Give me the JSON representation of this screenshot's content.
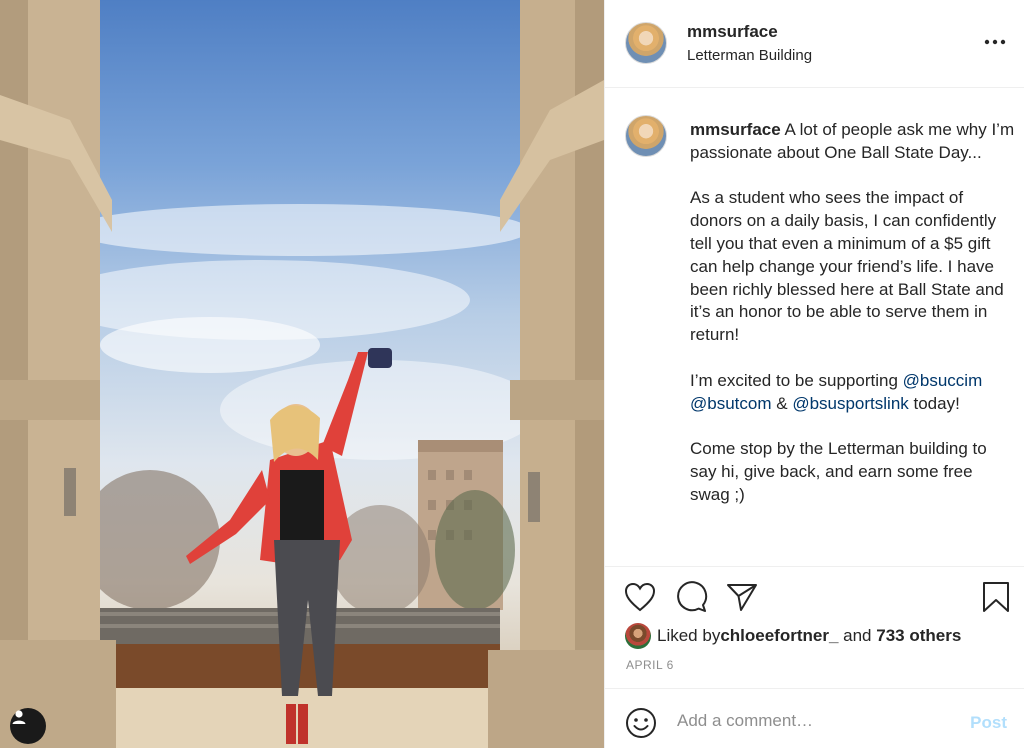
{
  "post": {
    "username": "mmsurface",
    "location": "Letterman Building",
    "caption": {
      "username": "mmsurface",
      "intro": "A lot of people ask me why I’m passionate about One Ball State Day...",
      "paragraph2": "As a student who sees the impact of donors on a daily basis, I can confidently tell you that even a minimum of a $5 gift can help change your friend’s life. I have been richly blessed here at Ball State and it’s an honor to be able to serve them in return!",
      "p3_prefix": "I’m excited to be supporting ",
      "mentions": [
        "@bsuccim",
        "@bsutcom",
        "@bsusportslink"
      ],
      "p3_amp": " & ",
      "p3_suffix": " today!",
      "paragraph4": "Come stop by the Letterman building to say hi, give back, and earn some free swag ;)"
    },
    "likes": {
      "prefix": "Liked by ",
      "user": "chloeefortner_",
      "middle": " and ",
      "others": "733 others"
    },
    "date": "APRIL 6"
  },
  "comment": {
    "placeholder": "Add a comment…",
    "post_label": "Post"
  },
  "icons": {
    "like": "heart-icon",
    "comment": "comment-icon",
    "share": "paper-plane-icon",
    "save": "bookmark-icon",
    "more": "more-options-icon",
    "emoji": "emoji-icon",
    "user_tag": "user-tag-icon"
  },
  "colors": {
    "mention": "#00376b",
    "secondary_text": "#8e8e8e",
    "post_button_disabled": "#b2dffc"
  }
}
